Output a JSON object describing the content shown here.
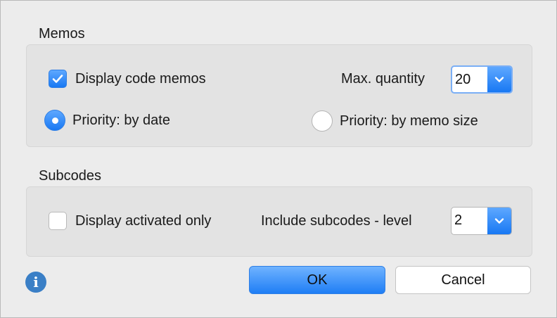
{
  "memos": {
    "title": "Memos",
    "display_code_memos": {
      "label": "Display code memos",
      "checked": true
    },
    "max_quantity": {
      "label": "Max. quantity",
      "value": "20"
    },
    "priority_by_date": {
      "label": "Priority: by date",
      "selected": true
    },
    "priority_by_memo_size": {
      "label": "Priority: by memo size",
      "selected": false
    }
  },
  "subcodes": {
    "title": "Subcodes",
    "display_activated_only": {
      "label": "Display activated only",
      "checked": false
    },
    "include_level": {
      "label": "Include subcodes - level",
      "value": "2"
    }
  },
  "footer": {
    "ok_label": "OK",
    "cancel_label": "Cancel",
    "info_icon": "info-icon"
  },
  "colors": {
    "accent": "#1878f3",
    "info": "#3a7fc6",
    "window_bg": "#ececec",
    "group_bg": "#e3e3e3"
  }
}
